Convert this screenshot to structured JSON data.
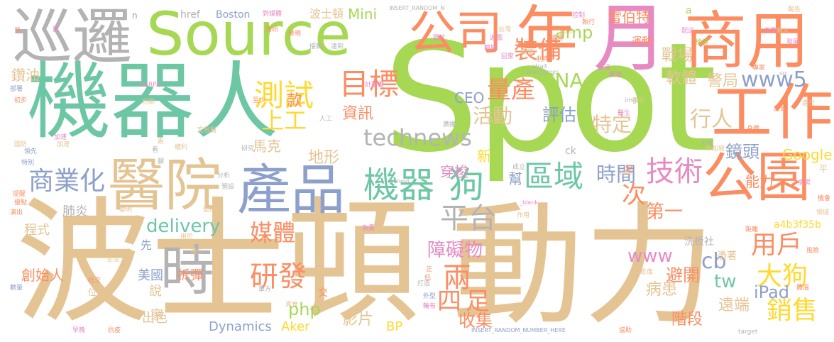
{
  "words": [
    {
      "text": "機器人",
      "color": "#6dc7a5"
    },
    {
      "text": "Spot",
      "color": "#a6d854"
    },
    {
      "text": "波士頓",
      "color": "#e5c494"
    },
    {
      "text": "動力",
      "color": "#e5c494"
    },
    {
      "text": "Source",
      "color": "#a6d854"
    },
    {
      "text": "商用",
      "color": "#fc8d62"
    },
    {
      "text": "巡邏",
      "color": "#b3b3b3"
    },
    {
      "text": "年",
      "color": "#fc8d62"
    },
    {
      "text": "月",
      "color": "#e78ac3"
    },
    {
      "text": "公司",
      "color": "#fc8d62"
    },
    {
      "text": "工作",
      "color": "#fc8d62"
    },
    {
      "text": "公園",
      "color": "#fc8d62"
    },
    {
      "text": "醫院",
      "color": "#e5c494"
    },
    {
      "text": "產品",
      "color": "#8da0cb"
    },
    {
      "text": "機器",
      "color": "#6dc7a5"
    },
    {
      "text": "狗",
      "color": "#6dc7a5"
    },
    {
      "text": "時",
      "color": "#b3b3b3"
    },
    {
      "text": "測試",
      "color": "#ffd92f"
    },
    {
      "text": "目標",
      "color": "#fc8d62"
    },
    {
      "text": "technews",
      "color": "#b3b3b3"
    },
    {
      "text": "裝備",
      "color": "#fc8d62"
    },
    {
      "text": "amp",
      "color": "#a6d854"
    },
    {
      "text": "CNA",
      "color": "#a6d854"
    },
    {
      "text": "www5",
      "color": "#8da0cb"
    },
    {
      "text": "技術",
      "color": "#e78ac3"
    },
    {
      "text": "區域",
      "color": "#6dc7a5"
    },
    {
      "text": "平台",
      "color": "#b3b3b3"
    },
    {
      "text": "商業化",
      "color": "#8da0cb"
    },
    {
      "text": "研發",
      "color": "#fc8d62"
    },
    {
      "text": "媒體",
      "color": "#fc8d62"
    },
    {
      "text": "兩",
      "color": "#fc8d62"
    },
    {
      "text": "四足",
      "color": "#fc8d62"
    },
    {
      "text": "大狗",
      "color": "#ffd92f"
    },
    {
      "text": "用戶",
      "color": "#fc8d62"
    },
    {
      "text": "銷售",
      "color": "#ffd92f"
    },
    {
      "text": "delivery",
      "color": "#6dc7a5"
    },
    {
      "text": "www",
      "color": "#e78ac3"
    },
    {
      "text": "次",
      "color": "#fc8d62"
    },
    {
      "text": "第一",
      "color": "#fc8d62"
    },
    {
      "text": "量產",
      "color": "#fc8d62"
    },
    {
      "text": "活動",
      "color": "#e5c494"
    },
    {
      "text": "上工",
      "color": "#ffd92f"
    },
    {
      "text": "行人",
      "color": "#e5c494"
    },
    {
      "text": "特定",
      "color": "#e5c494"
    },
    {
      "text": "時間",
      "color": "#8da0cb"
    },
    {
      "text": "雷伯特",
      "color": "#fc8d62"
    },
    {
      "text": "戰場",
      "color": "#e5c494"
    },
    {
      "text": "軟體",
      "color": "#e5c494"
    },
    {
      "text": "警局",
      "color": "#e5c494"
    },
    {
      "text": "評估",
      "color": "#8da0cb"
    },
    {
      "text": "鏡頭",
      "color": "#8da0cb"
    },
    {
      "text": "Google",
      "color": "#ffd92f"
    },
    {
      "text": "能力",
      "color": "#fc8d62"
    },
    {
      "text": "cb",
      "color": "#8da0cb"
    },
    {
      "text": "tw",
      "color": "#6dc7a5"
    },
    {
      "text": "iPad",
      "color": "#8da0cb"
    },
    {
      "text": "php",
      "color": "#a6d854"
    },
    {
      "text": "障礙物",
      "color": "#e78ac3"
    },
    {
      "text": "避開",
      "color": "#fc8d62"
    },
    {
      "text": "病患",
      "color": "#e5c494"
    },
    {
      "text": "遠端",
      "color": "#e5c494"
    },
    {
      "text": "階段",
      "color": "#fc8d62"
    },
    {
      "text": "收集",
      "color": "#fc8d62"
    },
    {
      "text": "影片",
      "color": "#e5c494"
    },
    {
      "text": "Aker",
      "color": "#ffd92f"
    },
    {
      "text": "Mini",
      "color": "#a6d854"
    },
    {
      "text": "BP",
      "color": "#ffd92f"
    },
    {
      "text": "拆彈",
      "color": "#fc8d62"
    },
    {
      "text": "美國",
      "color": "#8da0cb"
    },
    {
      "text": "創始人",
      "color": "#fc8d62"
    },
    {
      "text": "出色",
      "color": "#e5c494"
    },
    {
      "text": "說",
      "color": "#e5c494"
    },
    {
      "text": "家",
      "color": "#e5c494"
    },
    {
      "text": "Dynamics",
      "color": "#8da0cb"
    },
    {
      "text": "肺炎",
      "color": "#b3b3b3"
    },
    {
      "text": "程式",
      "color": "#e5c494"
    },
    {
      "text": "先",
      "color": "#8da0cb"
    },
    {
      "text": "鑽油",
      "color": "#e5c494"
    },
    {
      "text": "資訊",
      "color": "#fc8d62"
    },
    {
      "text": "款",
      "color": "#fc8d62"
    },
    {
      "text": "CEO",
      "color": "#8da0cb"
    },
    {
      "text": "地形",
      "color": "#e5c494"
    },
    {
      "text": "穿梭",
      "color": "#e78ac3"
    },
    {
      "text": "幫",
      "color": "#8da0cb"
    },
    {
      "text": "新",
      "color": "#ffd92f"
    },
    {
      "text": "馬克",
      "color": "#e5c494"
    },
    {
      "text": "洗板社",
      "color": "#b3b3b3"
    },
    {
      "text": "憑著",
      "color": "#e5c494"
    },
    {
      "text": "a4b3f35b",
      "color": "#ffd92f"
    },
    {
      "text": "波士頓",
      "color": "#e5c494"
    },
    {
      "text": "href",
      "color": "#b3b3b3"
    },
    {
      "text": "Boston",
      "color": "#8da0cb"
    },
    {
      "text": "運動",
      "color": "#fc8d62"
    },
    {
      "text": "ck",
      "color": "#b3b3b3"
    },
    {
      "text": "a",
      "color": "#a6d854"
    },
    {
      "text": "n",
      "color": "#8da0cb"
    },
    {
      "text": "INSERT_RANDOM_N",
      "color": "#b3b3b3"
    },
    {
      "text": "INSERT_RANDOM_NUMBER_HERE",
      "color": "#8da0cb"
    },
    {
      "text": "對媒體",
      "color": "#e78ac3"
    },
    {
      "text": "strait",
      "color": "#b3b3b3"
    },
    {
      "text": "straitstimes",
      "color": "#b3b3b3"
    },
    {
      "text": "zoneid",
      "color": "#b3b3b3"
    },
    {
      "text": "target",
      "color": "#b3b3b3"
    },
    {
      "text": "_blank",
      "color": "#e78ac3"
    },
    {
      "text": "img",
      "color": "#b3b3b3"
    },
    {
      "text": "src",
      "color": "#b3b3b3"
    },
    {
      "text": "DARPA",
      "color": "#e78ac3"
    },
    {
      "text": "研究",
      "color": "#b3b3b3"
    },
    {
      "text": "醫生",
      "color": "#e78ac3"
    },
    {
      "text": "成立",
      "color": "#b3b3b3"
    },
    {
      "text": "作用",
      "color": "#e5c494"
    },
    {
      "text": "生活",
      "color": "#e5c494"
    },
    {
      "text": "數量",
      "color": "#8da0cb"
    },
    {
      "text": "社交",
      "color": "#fc8d62"
    },
    {
      "text": "早晚",
      "color": "#e78ac3"
    },
    {
      "text": "抗疫",
      "color": "#fc8d62"
    },
    {
      "text": "協助",
      "color": "#fc8d62"
    },
    {
      "text": "影像",
      "color": "#e5c494"
    },
    {
      "text": "風險",
      "color": "#fc8d62"
    },
    {
      "text": "名為",
      "color": "#e5c494"
    },
    {
      "text": "足",
      "color": "#fc8d62"
    },
    {
      "text": "距離",
      "color": "#fc8d62"
    },
    {
      "text": "人員",
      "color": "#b3b3b3"
    },
    {
      "text": "病房",
      "color": "#e78ac3"
    },
    {
      "text": "新加坡",
      "color": "#e5c494"
    },
    {
      "text": "身體",
      "color": "#fc8d62"
    },
    {
      "text": "機場",
      "color": "#a6d854"
    },
    {
      "text": "加速",
      "color": "#e78ac3"
    },
    {
      "text": "領先",
      "color": "#8da0cb"
    },
    {
      "text": "特別",
      "color": "#8da0cb"
    },
    {
      "text": "提醒",
      "color": "#fc8d62"
    },
    {
      "text": "優點",
      "color": "#fc8d62"
    },
    {
      "text": "演出",
      "color": "#fc8d62"
    },
    {
      "text": "蔡明",
      "color": "#e5c494"
    },
    {
      "text": "自動",
      "color": "#e5c494"
    },
    {
      "text": "初步",
      "color": "#fc8d62"
    },
    {
      "text": "國防",
      "color": "#e5c494"
    },
    {
      "text": "部署",
      "color": "#8da0cb"
    },
    {
      "text": "人工",
      "color": "#b3b3b3"
    },
    {
      "text": "宏恩醫",
      "color": "#e5c494"
    },
    {
      "text": "權利",
      "color": "#e5c494"
    },
    {
      "text": "距",
      "color": "#e5c494"
    },
    {
      "text": "計劃書",
      "color": "#e78ac3"
    },
    {
      "text": "資訊",
      "color": "#fc8d62"
    },
    {
      "text": "發展",
      "color": "#e78ac3"
    },
    {
      "text": "加速",
      "color": "#e5c494"
    },
    {
      "text": "至少",
      "color": "#fc8d62"
    },
    {
      "text": "圖片",
      "color": "#e78ac3"
    },
    {
      "text": "分析",
      "color": "#b3b3b3"
    },
    {
      "text": "預設",
      "color": "#b3b3b3"
    },
    {
      "text": "監控",
      "color": "#e5c494"
    },
    {
      "text": "用於",
      "color": "#e5c494"
    },
    {
      "text": "減少",
      "color": "#e5c494"
    },
    {
      "text": "軍方",
      "color": "#b3b3b3"
    },
    {
      "text": "外型",
      "color": "#8da0cb"
    },
    {
      "text": "輪布",
      "color": "#e78ac3"
    },
    {
      "text": "打造",
      "color": "#b3b3b3"
    },
    {
      "text": "交",
      "color": "#fc8d62"
    },
    {
      "text": "正",
      "color": "#fc8d62"
    },
    {
      "text": "低",
      "color": "#fc8d62"
    },
    {
      "text": "位",
      "color": "#e5c494"
    },
    {
      "text": "腳",
      "color": "#b3b3b3"
    },
    {
      "text": "真實",
      "color": "#e5c494"
    },
    {
      "text": "負責",
      "color": "#e78ac3"
    },
    {
      "text": "處理",
      "color": "#fc8d62"
    },
    {
      "text": "買",
      "color": "#fc8d62"
    },
    {
      "text": "達到",
      "color": "#b3b3b3"
    },
    {
      "text": "發現",
      "color": "#fc8d62"
    },
    {
      "text": "接觸",
      "color": "#b3b3b3"
    },
    {
      "text": "無人",
      "color": "#e5c494"
    },
    {
      "text": "台灣",
      "color": "#e5c494"
    },
    {
      "text": "遊戲",
      "color": "#e78ac3"
    },
    {
      "text": "數據",
      "color": "#e78ac3"
    },
    {
      "text": "回家",
      "color": "#e78ac3"
    },
    {
      "text": "觀察",
      "color": "#e5c494"
    },
    {
      "text": "利用",
      "color": "#fc8d62"
    },
    {
      "text": "使用",
      "color": "#fc8d62"
    },
    {
      "text": "控制",
      "color": "#e78ac3"
    },
    {
      "text": "執行",
      "color": "#fc8d62"
    },
    {
      "text": "帳號",
      "color": "#e78ac3"
    },
    {
      "text": "查看",
      "color": "#e78ac3"
    },
    {
      "text": "專家",
      "color": "#fc8d62"
    },
    {
      "text": "報告",
      "color": "#e5c494"
    },
    {
      "text": "進行",
      "color": "#e5c494"
    },
    {
      "text": "領域",
      "color": "#e5c494"
    },
    {
      "text": "平",
      "color": "#e5c494"
    },
    {
      "text": "機會",
      "color": "#fc8d62"
    },
    {
      "text": "體溫",
      "color": "#fc8d62"
    },
    {
      "text": "頻道",
      "color": "#e78ac3"
    },
    {
      "text": "廣播",
      "color": "#b3b3b3"
    },
    {
      "text": "配送",
      "color": "#e78ac3"
    },
    {
      "text": "表示",
      "color": "#e5c494"
    },
    {
      "text": "設計",
      "color": "#fc8d62"
    },
    {
      "text": "項目",
      "color": "#e5c494"
    },
    {
      "text": "看",
      "color": "#b3b3b3"
    },
    {
      "text": "買",
      "color": "#e78ac3"
    }
  ]
}
